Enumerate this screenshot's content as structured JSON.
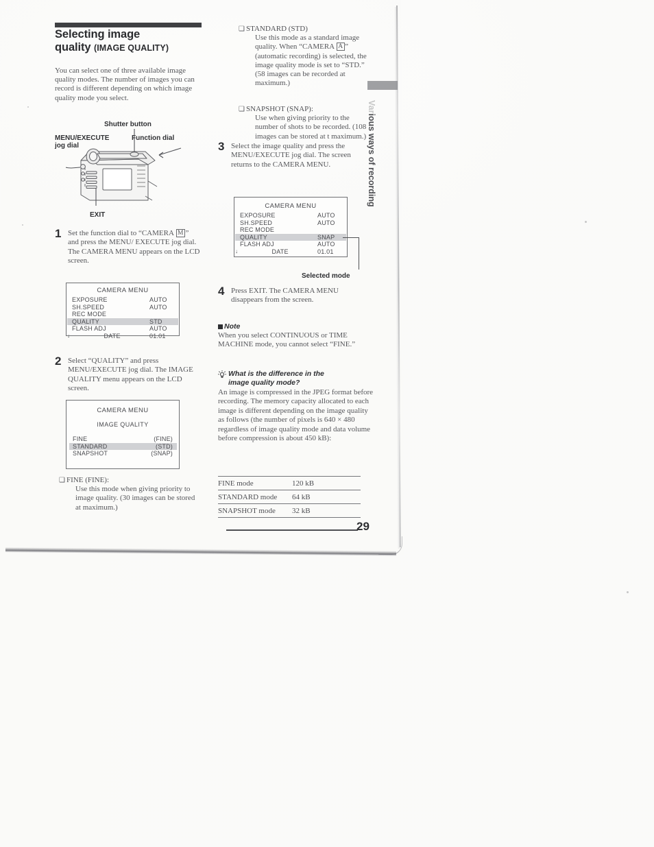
{
  "page": {
    "number": "29",
    "side_tab": "Various ways of recording",
    "side_tab_visible": "ious ways of recording"
  },
  "heading": {
    "title_line1": "Selecting image",
    "title_line2": "quality",
    "title_suffix": "(IMAGE QUALITY)"
  },
  "intro": "You can select one of three available image quality modes. The number of images you can record is different depending on which image quality mode you select.",
  "figure": {
    "shutter_button_label": "Shutter button",
    "menu_execute_label": "MENU/EXECUTE",
    "jog_dial_label": "jog dial",
    "function_dial_label": "Function dial",
    "exit_label": "EXIT",
    "selected_mode_label": "Selected mode"
  },
  "steps": [
    {
      "number": "1",
      "text_before_key": "Set the function dial to “CAMERA ",
      "key": "M",
      "text_after_key": "” and press the MENU/ EXECUTE jog dial. The CAMERA MENU appears on the LCD screen."
    },
    {
      "number": "2",
      "text": "Select “QUALITY” and press MENU/EXECUTE jog dial. The IMAGE QUALITY menu appears on the LCD screen."
    },
    {
      "number": "3",
      "text": "Select the image quality and press the MENU/EXECUTE jog dial. The screen returns to the CAMERA MENU."
    },
    {
      "number": "4",
      "text": "Press EXIT. The CAMERA  MENU disappears from the screen."
    }
  ],
  "lcd_menu_1": {
    "title": "CAMERA MENU",
    "rows": [
      {
        "label": "EXPOSURE",
        "value": "AUTO",
        "highlight": false,
        "arrow": ""
      },
      {
        "label": "SH.SPEED",
        "value": "AUTO",
        "highlight": false,
        "arrow": ""
      },
      {
        "label": "REC MODE",
        "value": "",
        "highlight": false,
        "arrow": ""
      },
      {
        "label": "QUALITY",
        "value": "STD",
        "highlight": true,
        "arrow": ""
      },
      {
        "label": "FLASH ADJ",
        "value": "AUTO",
        "highlight": false,
        "arrow": ""
      },
      {
        "label": "DATE",
        "value": "01.01",
        "highlight": false,
        "arrow": "↓"
      }
    ]
  },
  "lcd_menu_2": {
    "title": "CAMERA MENU",
    "subtitle": "IMAGE QUALITY",
    "rows": [
      {
        "label": "FINE",
        "value": "(FINE)",
        "highlight": false
      },
      {
        "label": "STANDARD",
        "value": "(STD)",
        "highlight": true
      },
      {
        "label": "SNAPSHOT",
        "value": "(SNAP)",
        "highlight": false
      }
    ]
  },
  "lcd_menu_3": {
    "title": "CAMERA MENU",
    "rows": [
      {
        "label": "EXPOSURE",
        "value": "AUTO",
        "highlight": false,
        "arrow": ""
      },
      {
        "label": "SH.SPEED",
        "value": "AUTO",
        "highlight": false,
        "arrow": ""
      },
      {
        "label": "REC MODE",
        "value": "",
        "highlight": false,
        "arrow": ""
      },
      {
        "label": "QUALITY",
        "value": "SNAP",
        "highlight": true,
        "arrow": ""
      },
      {
        "label": "FLASH ADJ",
        "value": "AUTO",
        "highlight": false,
        "arrow": ""
      },
      {
        "label": "DATE",
        "value": "01.01",
        "highlight": false,
        "arrow": "↓"
      }
    ]
  },
  "bullets": {
    "fine": {
      "head": "FINE (FINE):",
      "body": "Use this mode when giving priority to image quality. (30 images can be stored at maximum.)"
    },
    "standard": {
      "head": "STANDARD (STD)",
      "body_part1": "Use this mode as a standard image quality. When “CAMERA ",
      "key": "A",
      "body_part2": "” (automatic recording) is selected, the image quality mode is set to “STD.”  (58 images can be recorded at maximum.)"
    },
    "snapshot": {
      "head": "SNAPSHOT (SNAP):",
      "body": "Use when giving priority to the number of shots to be recorded. (108 images can be stored at t maximum.)"
    }
  },
  "note": {
    "heading": "Note",
    "text": "When you select CONTINUOUS or TIME MACHINE mode, you cannot select “FINE.”"
  },
  "tip": {
    "heading_line1": "What is the difference in the",
    "heading_line2": "image quality mode?",
    "text": "An image is compressed in the JPEG format before recording. The memory capacity allocated to each image is different depending on the image quality as follows (the number of pixels is 640 × 480 regardless of image quality mode and data volume before compression is about 450 kB):"
  },
  "kb_table": {
    "rows": [
      {
        "mode": "FINE mode",
        "size": "120 kB"
      },
      {
        "mode": "STANDARD mode",
        "size": "64 kB"
      },
      {
        "mode": "SNAPSHOT mode",
        "size": "32 kB"
      }
    ]
  },
  "colors": {
    "ink": "#55565a",
    "heading_ink": "#2b2c2f",
    "rule": "#2f3033",
    "highlight": "#c8c9cc"
  }
}
